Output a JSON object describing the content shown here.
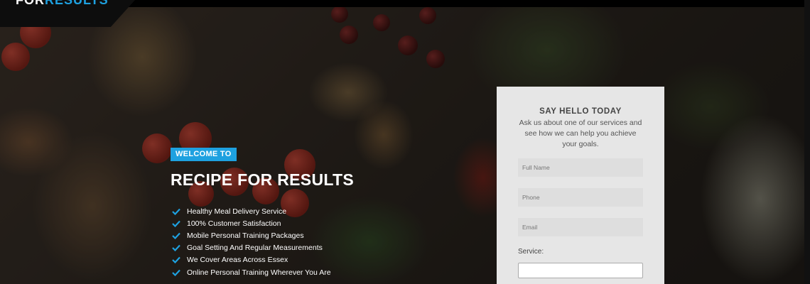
{
  "brand": {
    "logo_prefix": "FOR",
    "logo_accent": "RESULTS",
    "accent_color": "#1ea1e0"
  },
  "hero": {
    "badge": "WELCOME TO",
    "title": "RECIPE FOR RESULTS",
    "benefits": [
      "Healthy Meal Delivery Service",
      "100% Customer Satisfaction",
      "Mobile Personal Training Packages",
      "Goal Setting And Regular Measurements",
      "We Cover Areas Across Essex",
      "Online Personal Training Wherever You Are"
    ],
    "benefit_icon": "check-icon"
  },
  "contact_form": {
    "title": "SAY HELLO TODAY",
    "description": "Ask us about one of our services and see how we can help you achieve your goals.",
    "full_name_placeholder": "Full Name",
    "phone_placeholder": "Phone",
    "email_placeholder": "Email",
    "service_label": "Service:",
    "service_value": ""
  }
}
